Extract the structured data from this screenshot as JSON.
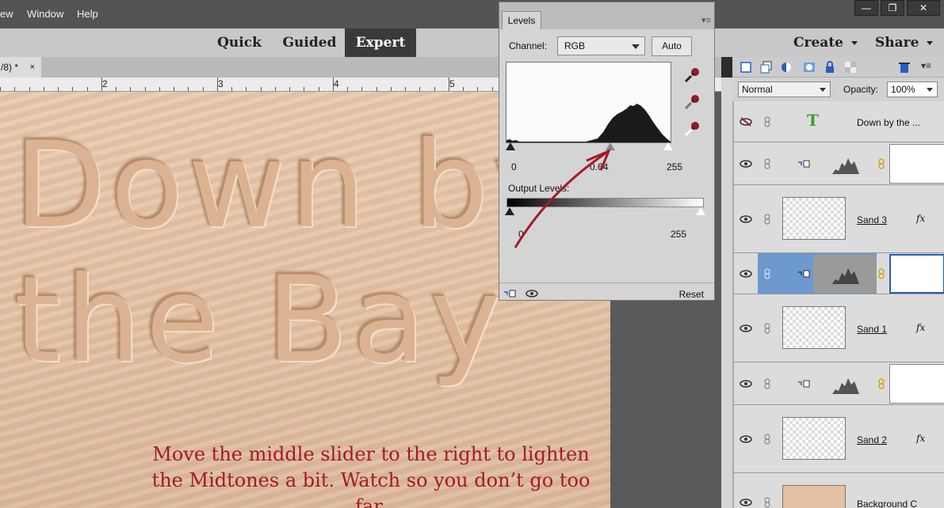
{
  "menu": {
    "items": [
      "ew",
      "Window",
      "Help"
    ]
  },
  "window_controls": {
    "minimize": "—",
    "restore": "❐",
    "close": "✕"
  },
  "modes": {
    "quick": "Quick",
    "guided": "Guided",
    "expert": "Expert",
    "active": "Expert"
  },
  "actions": {
    "create": "Create",
    "share": "Share"
  },
  "document": {
    "tab_label": "/8) *",
    "close": "×"
  },
  "ruler": {
    "labels": [
      "2",
      "3",
      "4",
      "5"
    ]
  },
  "canvas": {
    "title_line1": "Down by",
    "title_line2": "the Bay",
    "instruction_line1": "Move the middle slider to the right to lighten",
    "instruction_line2": "the Midtones a bit. Watch so you don’t go too far.",
    "accent_color": "#a31a28"
  },
  "levels": {
    "tab": "Levels",
    "channel_label": "Channel:",
    "channel_value": "RGB",
    "auto_label": "Auto",
    "input_black": "0",
    "input_mid": "0.64",
    "input_white": "255",
    "output_label": "Output Levels:",
    "output_black": "0",
    "output_white": "255",
    "reset_label": "Reset"
  },
  "layers_panel": {
    "blend_mode": "Normal",
    "opacity_label": "Opacity:",
    "opacity_value": "100%",
    "layers": [
      {
        "name": "Down by the ...",
        "type": "text",
        "visible": false
      },
      {
        "name": "",
        "type": "adjustment-levels"
      },
      {
        "name": "Sand 3",
        "type": "pixel",
        "fx": "fx"
      },
      {
        "name": "",
        "type": "adjustment-levels",
        "selected": true
      },
      {
        "name": "Sand 1",
        "type": "pixel",
        "fx": "fx"
      },
      {
        "name": "",
        "type": "adjustment-levels"
      },
      {
        "name": "Sand 2",
        "type": "pixel",
        "fx": "fx"
      },
      {
        "name": "Background C",
        "type": "pixel"
      }
    ]
  }
}
